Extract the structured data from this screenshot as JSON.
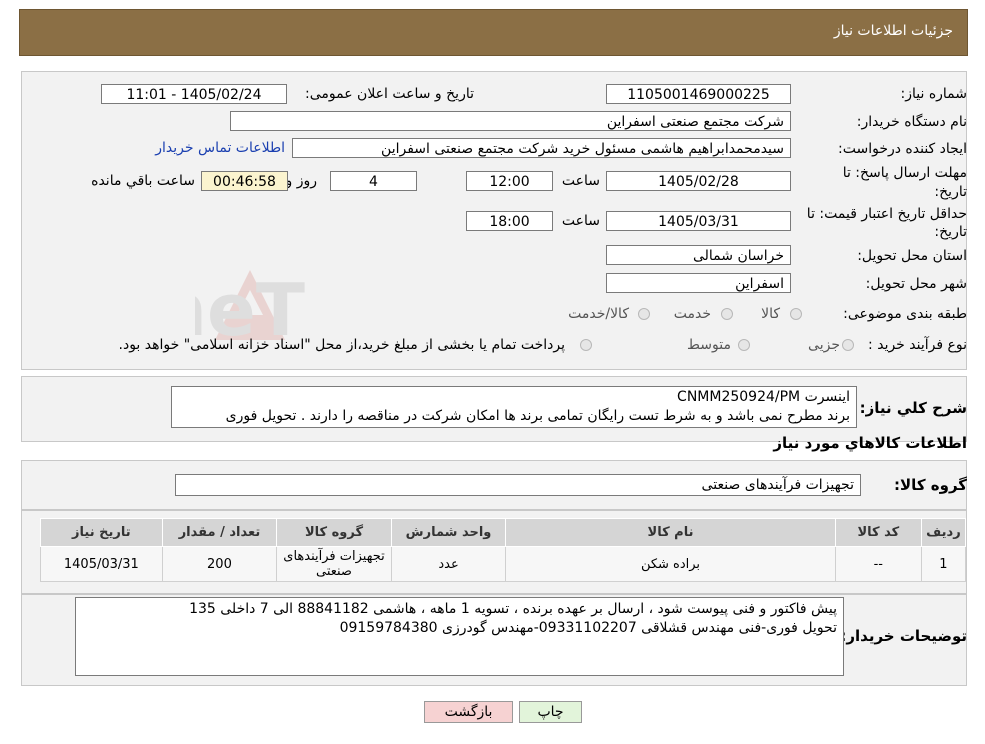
{
  "header": {
    "title": "جزئیات اطلاعات نیاز"
  },
  "form": {
    "need_number_label": "شماره نیاز:",
    "need_number": "1105001469000225",
    "announce_label": "تاریخ و ساعت اعلان عمومی:",
    "announce_value": "1405/02/24 - 11:01",
    "buyer_org_label": "نام دستگاه خریدار:",
    "buyer_org": "شرکت مجتمع صنعتی اسفراین",
    "creator_label": "ایجاد کننده درخواست:",
    "creator": "سیدمحمدابراهیم هاشمی مسئول خرید شرکت مجتمع صنعتی اسفراین",
    "contact_link": "اطلاعات تماس خریدار",
    "deadline_label_1": "مهلت ارسال پاسخ: تا",
    "deadline_label_2": "تاریخ:",
    "deadline_date": "1405/02/28",
    "time_word": "ساعت",
    "deadline_time": "12:00",
    "days_value": "4",
    "days_word": "روز و",
    "remaining_value": "00:46:58",
    "remaining_word": "ساعت باقي مانده",
    "validity_label_1": "حداقل تاریخ اعتبار قیمت: تا",
    "validity_label_2": "تاریخ:",
    "validity_date": "1405/03/31",
    "validity_time": "18:00",
    "province_label": "استان محل تحویل:",
    "province": "خراسان شمالی",
    "city_label": "شهر محل تحویل:",
    "city": "اسفراین",
    "category_label": "طبقه بندی موضوعی:",
    "category_options": [
      "کالا",
      "خدمت",
      "کالا/خدمت"
    ],
    "purchase_type_label": "نوع فرآیند خرید :",
    "purchase_options": [
      "جزیی",
      "متوسط"
    ],
    "purchase_note": "پرداخت تمام یا بخشی از مبلغ خرید،از محل \"اسناد خزانه اسلامی\" خواهد بود."
  },
  "summary": {
    "label": "شرح کلي نياز:",
    "line1": "اینسرت CNMM250924/PM",
    "line2": "برند مطرح نمی باشد و به شرط تست رایگان تمامی برند ها امکان شرکت در مناقصه را دارند . تحویل فوری"
  },
  "goods_section_title": "اطلاعات کالاهاي مورد نياز",
  "goods_group_label": "گروه کالا:",
  "goods_group": "تجهیزات فرآیندهای صنعتی",
  "table": {
    "headers": [
      "رديف",
      "کد کالا",
      "نام کالا",
      "واحد شمارش",
      "گروه کالا",
      "تعداد / مقدار",
      "تاریخ نیاز"
    ],
    "rows": [
      [
        "1",
        "--",
        "براده شکن",
        "عدد",
        "تجهیزات فرآیندهای صنعتی",
        "200",
        "1405/03/31"
      ]
    ]
  },
  "buyer_notes": {
    "label": "توضیحات خریدار:",
    "line1": "پیش فاکتور و فنی پیوست شود ، ارسال بر عهده برنده ، تسویه 1 ماهه ، هاشمی 88841182 الی 7 داخلی 135",
    "line2": "تحویل فوری-فنی مهندس قشلاقی 09331102207-مهندس گودرزی 09159784380"
  },
  "buttons": {
    "print": "چاپ",
    "back": "بازگشت"
  },
  "watermark": {
    "text": "AriaTender.neT"
  },
  "colors": {
    "header_bg": "#8b6f45",
    "link": "#1a3fb0",
    "back_btn": "#f6d2d2",
    "print_btn": "#e2f4da",
    "remaining_bg": "#fbf4cf"
  }
}
